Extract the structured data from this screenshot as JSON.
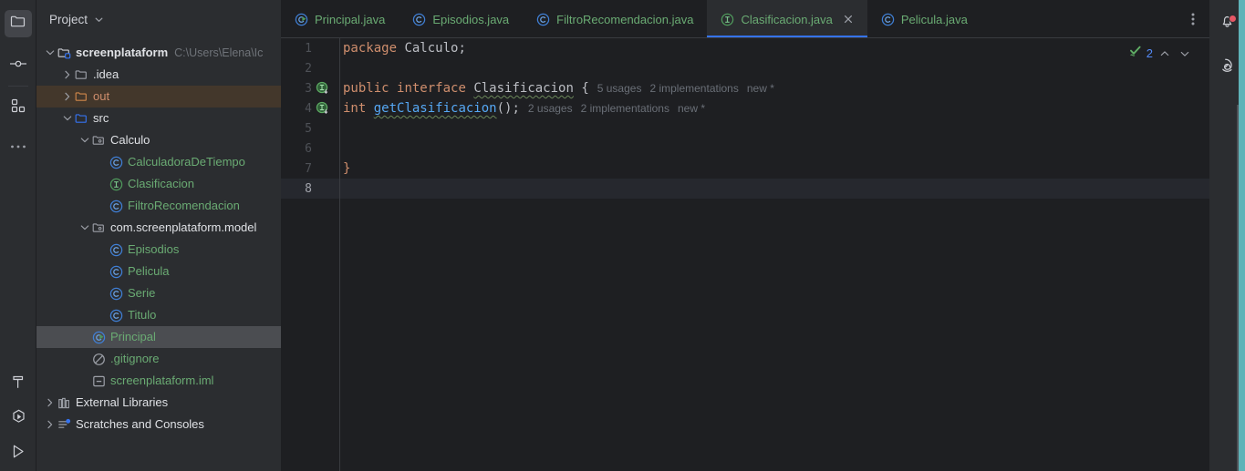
{
  "activity_bar": {
    "items": [
      {
        "name": "project",
        "icon": "folder-icon",
        "tooltip": "Project",
        "selected": true
      },
      {
        "name": "commit",
        "icon": "commit-icon",
        "tooltip": "Commit",
        "selected": false
      },
      {
        "name": "structure",
        "icon": "structure-icon",
        "tooltip": "Structure",
        "selected": false
      },
      {
        "name": "more",
        "icon": "more-ellipsis-icon",
        "tooltip": "More Tool Windows",
        "selected": false
      }
    ],
    "bottom_items": [
      {
        "name": "build",
        "icon": "hammer-icon",
        "tooltip": "Build"
      },
      {
        "name": "services",
        "icon": "services-play-icon",
        "tooltip": "Services"
      },
      {
        "name": "run",
        "icon": "run-play-icon",
        "tooltip": "Run"
      }
    ]
  },
  "project_panel": {
    "title": "Project",
    "dropdown_icon": "chevron-down-icon",
    "tree": [
      {
        "label": "screenplataform",
        "sub": "C:\\Users\\Elena\\Ic",
        "icon": "module-folder-icon",
        "arrow": "down",
        "indent": 0,
        "style": "white-bold",
        "state": "normal"
      },
      {
        "label": ".idea",
        "sub": "",
        "icon": "folder-icon",
        "arrow": "right",
        "indent": 1,
        "style": "white",
        "state": "normal"
      },
      {
        "label": "out",
        "sub": "",
        "icon": "folder-orange-icon",
        "arrow": "right",
        "indent": 1,
        "style": "orange",
        "state": "excluded"
      },
      {
        "label": "src",
        "sub": "",
        "icon": "folder-source-icon",
        "arrow": "down",
        "indent": 1,
        "style": "white",
        "state": "normal"
      },
      {
        "label": "Calculo",
        "sub": "",
        "icon": "package-icon",
        "arrow": "down",
        "indent": 2,
        "style": "white",
        "state": "normal"
      },
      {
        "label": "CalculadoraDeTiempo",
        "sub": "",
        "icon": "class-icon",
        "arrow": "none",
        "indent": 3,
        "style": "green",
        "state": "normal"
      },
      {
        "label": "Clasificacion",
        "sub": "",
        "icon": "interface-icon",
        "arrow": "none",
        "indent": 3,
        "style": "green",
        "state": "normal"
      },
      {
        "label": "FiltroRecomendacion",
        "sub": "",
        "icon": "class-icon",
        "arrow": "none",
        "indent": 3,
        "style": "green",
        "state": "normal"
      },
      {
        "label": "com.screenplataform.model",
        "sub": "",
        "icon": "package-icon",
        "arrow": "down",
        "indent": 2,
        "style": "white",
        "state": "normal"
      },
      {
        "label": "Episodios",
        "sub": "",
        "icon": "class-icon",
        "arrow": "none",
        "indent": 3,
        "style": "green",
        "state": "normal"
      },
      {
        "label": "Pelicula",
        "sub": "",
        "icon": "class-icon",
        "arrow": "none",
        "indent": 3,
        "style": "green",
        "state": "normal"
      },
      {
        "label": "Serie",
        "sub": "",
        "icon": "class-icon",
        "arrow": "none",
        "indent": 3,
        "style": "green",
        "state": "normal"
      },
      {
        "label": "Titulo",
        "sub": "",
        "icon": "class-icon",
        "arrow": "none",
        "indent": 3,
        "style": "green",
        "state": "normal"
      },
      {
        "label": "Principal",
        "sub": "",
        "icon": "runnable-class-icon",
        "arrow": "none",
        "indent": 2,
        "style": "green",
        "state": "selected"
      },
      {
        "label": ".gitignore",
        "sub": "",
        "icon": "gitignore-icon",
        "arrow": "none",
        "indent": 2,
        "style": "green",
        "state": "normal"
      },
      {
        "label": "screenplataform.iml",
        "sub": "",
        "icon": "iml-file-icon",
        "arrow": "none",
        "indent": 2,
        "style": "green",
        "state": "normal"
      },
      {
        "label": "External Libraries",
        "sub": "",
        "icon": "libraries-icon",
        "arrow": "right",
        "indent": 0,
        "style": "white",
        "state": "normal"
      },
      {
        "label": "Scratches and Consoles",
        "sub": "",
        "icon": "scratches-icon",
        "arrow": "right",
        "indent": 0,
        "style": "white",
        "state": "normal"
      }
    ]
  },
  "editor": {
    "tabs": [
      {
        "label": "Principal.java",
        "icon": "runnable-class-icon",
        "active": false,
        "closable": false
      },
      {
        "label": "Episodios.java",
        "icon": "class-icon",
        "active": false,
        "closable": false
      },
      {
        "label": "FiltroRecomendacion.java",
        "icon": "class-icon",
        "active": false,
        "closable": false
      },
      {
        "label": "Clasificacion.java",
        "icon": "interface-icon",
        "active": true,
        "closable": true
      },
      {
        "label": "Pelicula.java",
        "icon": "class-icon",
        "active": false,
        "closable": false
      }
    ],
    "tab_overflow_icon": "kebab-menu-icon",
    "inspection": {
      "status_icon": "inspection-ok-icon",
      "count": "2",
      "prev_icon": "chevron-up-icon",
      "next_icon": "chevron-down-icon"
    },
    "current_line": 8,
    "lines": [
      {
        "number": "1",
        "gutter_icon": "",
        "tokens": [
          {
            "t": "package",
            "c": "kw"
          },
          {
            "t": " ",
            "c": "punct"
          },
          {
            "t": "Calculo",
            "c": "ident"
          },
          {
            "t": ";",
            "c": "punct"
          }
        ],
        "hints": []
      },
      {
        "number": "2",
        "gutter_icon": "",
        "tokens": [],
        "hints": []
      },
      {
        "number": "3",
        "gutter_icon": "implemented-interface-icon",
        "tokens": [
          {
            "t": "public",
            "c": "kw"
          },
          {
            "t": " ",
            "c": "punct"
          },
          {
            "t": "interface",
            "c": "kw"
          },
          {
            "t": " ",
            "c": "punct"
          },
          {
            "t": "Clasificacion",
            "c": "ident typo"
          },
          {
            "t": " {",
            "c": "punct"
          }
        ],
        "hints": [
          "5 usages",
          "2 implementations",
          "new *"
        ]
      },
      {
        "number": "4",
        "gutter_icon": "implemented-interface-icon",
        "tokens": [
          {
            "t": "int",
            "c": "kw"
          },
          {
            "t": " ",
            "c": "punct"
          },
          {
            "t": "getClasificacion",
            "c": "meth typo"
          },
          {
            "t": "();",
            "c": "punct"
          }
        ],
        "hints": [
          "2 usages",
          "2 implementations",
          "new *"
        ]
      },
      {
        "number": "5",
        "gutter_icon": "",
        "tokens": [],
        "hints": []
      },
      {
        "number": "6",
        "gutter_icon": "",
        "tokens": [],
        "hints": []
      },
      {
        "number": "7",
        "gutter_icon": "",
        "tokens": [
          {
            "t": "}",
            "c": "kw"
          }
        ],
        "hints": []
      },
      {
        "number": "8",
        "gutter_icon": "",
        "tokens": [],
        "hints": []
      }
    ]
  },
  "right_bar": {
    "items": [
      {
        "name": "notifications",
        "icon": "bell-icon",
        "badge": true
      },
      {
        "name": "ai-assistant",
        "icon": "ai-swirl-icon",
        "badge": false
      }
    ]
  },
  "colors": {
    "accent_blue": "#3573f0",
    "keyword_orange": "#cf8e6d",
    "string_green": "#6aab73",
    "method_blue": "#56a8f5",
    "hint_gray": "#6a6f77",
    "excluded_bg": "#43372b",
    "selection_bg": "#4b4d51",
    "panel_bg": "#2b2d30",
    "editor_bg": "#1e1f22",
    "badge_red": "#e55765",
    "edge_teal": "#5fb3b8"
  }
}
